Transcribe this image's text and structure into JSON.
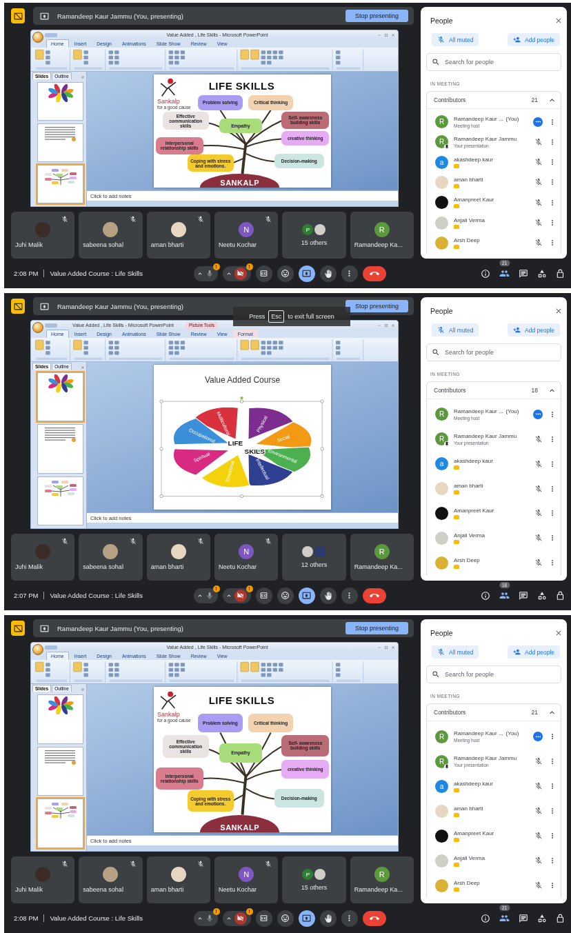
{
  "screens": [
    {
      "presenter_bar": {
        "label": "Ramandeep Kaur Jammu (You, presenting)",
        "button": "Stop presenting"
      },
      "ppt": {
        "title": "Value Added , Life Skills - Microsoft PowerPoint",
        "tabs": [
          {
            "label": "Home",
            "selected": true
          },
          {
            "label": "Insert",
            "selected": false
          },
          {
            "label": "Design",
            "selected": false
          },
          {
            "label": "Animations",
            "selected": false
          },
          {
            "label": "Slide Show",
            "selected": false
          },
          {
            "label": "Review",
            "selected": false
          },
          {
            "label": "View",
            "selected": false
          }
        ],
        "pane_tabs": [
          {
            "label": "Slides",
            "selected": true
          },
          {
            "label": "Outline",
            "selected": false
          }
        ],
        "thumbnails": [
          {
            "kind": "wheel",
            "selected": false
          },
          {
            "kind": "text",
            "selected": false
          },
          {
            "kind": "mindmap",
            "selected": true
          }
        ],
        "slide": {
          "kind": "mindmap",
          "title": "LIFE SKILLS",
          "logo": "Sankalp",
          "tagline": "for a good cause",
          "base": "SANKALP",
          "nodes": [
            {
              "text": "Problem solving",
              "color": "#a99cf2"
            },
            {
              "text": "Critical thinking",
              "color": "#f3d2b0"
            },
            {
              "text": "Effective communication skills",
              "color": "#e9e3e1"
            },
            {
              "text": "Empathy",
              "color": "#a9dc7a"
            },
            {
              "text": "Self- awareness building skills",
              "color": "#b96b76"
            },
            {
              "text": "creative thinking",
              "color": "#e6acf3"
            },
            {
              "text": "Interpersonal relationship skills",
              "color": "#d97c8e"
            },
            {
              "text": "Coping with stress and emotions.",
              "color": "#f4cb2e"
            },
            {
              "text": "Decision-making",
              "color": "#cbe6e1"
            }
          ]
        },
        "notes": "Click to add notes"
      },
      "tiles": [
        {
          "name": "Juhi Malik",
          "muted": true,
          "avatar": {
            "kind": "photo",
            "color": "#3b2c27"
          }
        },
        {
          "name": "sabeena sohal",
          "muted": true,
          "avatar": {
            "kind": "photo",
            "color": "#b7a185"
          }
        },
        {
          "name": "aman bharti",
          "muted": true,
          "avatar": {
            "kind": "photo",
            "color": "#e6d6c2"
          }
        },
        {
          "name": "Neetu Kochar",
          "muted": true,
          "avatar": {
            "kind": "letter",
            "letter": "N",
            "color": "#7e57c2"
          }
        },
        {
          "name": "15 others",
          "muted": false,
          "avatar": {
            "kind": "group",
            "members": [
              {
                "kind": "letter",
                "letter": "P",
                "color": "#2e7d32"
              },
              {
                "kind": "photo",
                "color": "#cfcfc8"
              }
            ]
          }
        },
        {
          "name": "Ramandeep Ka...",
          "muted": false,
          "avatar": {
            "kind": "letter",
            "letter": "R",
            "color": "#5b9a3c"
          }
        }
      ],
      "bar": {
        "time": "2:08 PM",
        "title": "Value Added Course : Life Skills",
        "controls": [
          {
            "kind": "mic-menu",
            "alert": "!"
          },
          {
            "kind": "camera-menu",
            "alert": "!"
          },
          {
            "kind": "captions"
          },
          {
            "kind": "emoji"
          },
          {
            "kind": "present",
            "on": true
          },
          {
            "kind": "hand"
          },
          {
            "kind": "more"
          },
          {
            "kind": "leave"
          }
        ],
        "side": [
          {
            "kind": "info"
          },
          {
            "kind": "people",
            "count": "21",
            "on": true
          },
          {
            "kind": "chat"
          },
          {
            "kind": "activities"
          },
          {
            "kind": "host-controls"
          }
        ]
      },
      "people": {
        "title": "People",
        "actions": [
          {
            "kind": "mute-all",
            "label": "All muted"
          },
          {
            "kind": "add",
            "label": "Add people"
          }
        ],
        "search": {
          "placeholder": "Search for people"
        },
        "section": "IN MEETING",
        "group": {
          "label": "Contributors",
          "count": "21",
          "expanded": true
        },
        "rows": [
          {
            "name": "Ramandeep Kaur ...",
            "tag": "(You)",
            "subtitle": "Meeting host",
            "badge": false,
            "kind": "more",
            "avatar": {
              "kind": "letter",
              "letter": "R",
              "color": "#5b9a3c",
              "pinned": false
            }
          },
          {
            "name": "Ramandeep Kaur Jammu",
            "subtitle": "Your presentation",
            "badge": false,
            "kind": "presentation",
            "avatar": {
              "kind": "letter",
              "letter": "R",
              "color": "#5b9a3c",
              "pinned": true
            }
          },
          {
            "name": "akashdeep kaur",
            "badge": true,
            "kind": "muted",
            "avatar": {
              "kind": "letter",
              "letter": "a",
              "color": "#1e88e5"
            }
          },
          {
            "name": "aman bharti",
            "badge": true,
            "kind": "muted",
            "avatar": {
              "kind": "photo",
              "color": "#e6d6c2"
            }
          },
          {
            "name": "Amanpreet Kaur",
            "badge": true,
            "kind": "muted",
            "avatar": {
              "kind": "photo",
              "color": "#111111"
            }
          },
          {
            "name": "Anjali Verma",
            "badge": true,
            "kind": "muted",
            "avatar": {
              "kind": "photo",
              "color": "#cfcfc8"
            }
          },
          {
            "name": "Arsh Deep",
            "badge": true,
            "kind": "muted",
            "avatar": {
              "kind": "photo",
              "color": "#d9b235"
            }
          }
        ]
      }
    },
    {
      "presenter_bar": {
        "label": "Ramandeep Kaur Jammu (You, presenting)",
        "button": "Stop presenting"
      },
      "esc_hint": {
        "before": "Press",
        "key": "Esc",
        "after": "to exit full screen"
      },
      "ppt": {
        "title": "Value Added , Life Skills - Microsoft PowerPoint",
        "context_label": "Picture Tools",
        "tabs": [
          {
            "label": "Home",
            "selected": true
          },
          {
            "label": "Insert",
            "selected": false
          },
          {
            "label": "Design",
            "selected": false
          },
          {
            "label": "Animations",
            "selected": false
          },
          {
            "label": "Slide Show",
            "selected": false
          },
          {
            "label": "Review",
            "selected": false
          },
          {
            "label": "View",
            "selected": false
          },
          {
            "label": "Format",
            "selected": false,
            "context": true
          }
        ],
        "pane_tabs": [
          {
            "label": "Slides",
            "selected": true
          },
          {
            "label": "Outline",
            "selected": false
          }
        ],
        "thumbnails": [
          {
            "kind": "wheel",
            "selected": true
          },
          {
            "kind": "text",
            "selected": false
          },
          {
            "kind": "mindmap",
            "selected": false
          }
        ],
        "slide": {
          "kind": "wheel",
          "title": "Value Added Course",
          "center_lines": [
            "LIFE",
            "SKILS"
          ],
          "picture_selected": true,
          "segments": [
            {
              "label": "Multicultural",
              "color": "#d9323e"
            },
            {
              "label": "Physical",
              "color": "#7d2d8f"
            },
            {
              "label": "Social",
              "color": "#f39a14"
            },
            {
              "label": "Environmental",
              "color": "#4caf50"
            },
            {
              "label": "Intellectual",
              "color": "#2f3f92"
            },
            {
              "label": "Emotional",
              "color": "#f3d20b"
            },
            {
              "label": "Spiritual",
              "color": "#d82a80"
            },
            {
              "label": "Occupational",
              "color": "#3c8fd9"
            }
          ]
        },
        "notes": "Click to add notes"
      },
      "tiles": [
        {
          "name": "Juhi Malik",
          "muted": true,
          "avatar": {
            "kind": "photo",
            "color": "#3b2c27"
          }
        },
        {
          "name": "sabeena sohal",
          "muted": true,
          "avatar": {
            "kind": "photo",
            "color": "#b7a185"
          }
        },
        {
          "name": "aman bharti",
          "muted": true,
          "avatar": {
            "kind": "photo",
            "color": "#e6d6c2"
          }
        },
        {
          "name": "Neetu Kochar",
          "muted": true,
          "avatar": {
            "kind": "letter",
            "letter": "N",
            "color": "#7e57c2"
          }
        },
        {
          "name": "12 others",
          "muted": false,
          "avatar": {
            "kind": "group",
            "members": [
              {
                "kind": "photo",
                "color": "#cfcfc8"
              },
              {
                "kind": "photo",
                "color": "#2a3a6a"
              }
            ]
          }
        },
        {
          "name": "Ramandeep Ka...",
          "muted": false,
          "avatar": {
            "kind": "letter",
            "letter": "R",
            "color": "#5b9a3c"
          }
        }
      ],
      "bar": {
        "time": "2:07 PM",
        "title": "Value Added Course : Life Skills",
        "controls": [
          {
            "kind": "mic-menu",
            "alert": "!"
          },
          {
            "kind": "camera-menu",
            "alert": "!"
          },
          {
            "kind": "captions"
          },
          {
            "kind": "emoji"
          },
          {
            "kind": "present",
            "on": true
          },
          {
            "kind": "hand"
          },
          {
            "kind": "more"
          },
          {
            "kind": "leave"
          }
        ],
        "side": [
          {
            "kind": "info"
          },
          {
            "kind": "people",
            "count": "18",
            "on": true
          },
          {
            "kind": "chat"
          },
          {
            "kind": "activities"
          },
          {
            "kind": "host-controls"
          }
        ]
      },
      "people": {
        "title": "People",
        "actions": [
          {
            "kind": "mute-all",
            "label": "All muted"
          },
          {
            "kind": "add",
            "label": "Add people"
          }
        ],
        "search": {
          "placeholder": "Search for people"
        },
        "section": "IN MEETING",
        "group": {
          "label": "Contributors",
          "count": "18",
          "expanded": true
        },
        "rows": [
          {
            "name": "Ramandeep Kaur ...",
            "tag": "(You)",
            "subtitle": "Meeting host",
            "badge": false,
            "kind": "more",
            "avatar": {
              "kind": "letter",
              "letter": "R",
              "color": "#5b9a3c",
              "pinned": false
            }
          },
          {
            "name": "Ramandeep Kaur Jammu",
            "subtitle": "Your presentation",
            "badge": false,
            "kind": "presentation",
            "avatar": {
              "kind": "letter",
              "letter": "R",
              "color": "#5b9a3c",
              "pinned": true
            }
          },
          {
            "name": "akashdeep kaur",
            "badge": true,
            "kind": "muted",
            "avatar": {
              "kind": "letter",
              "letter": "a",
              "color": "#1e88e5"
            }
          },
          {
            "name": "aman bharti",
            "badge": true,
            "kind": "muted",
            "avatar": {
              "kind": "photo",
              "color": "#e6d6c2"
            }
          },
          {
            "name": "Amanpreet Kaur",
            "badge": true,
            "kind": "muted",
            "avatar": {
              "kind": "photo",
              "color": "#111111"
            }
          },
          {
            "name": "Anjali Verma",
            "badge": true,
            "kind": "muted",
            "avatar": {
              "kind": "photo",
              "color": "#cfcfc8"
            }
          },
          {
            "name": "Arsh Deep",
            "badge": true,
            "kind": "muted",
            "avatar": {
              "kind": "photo",
              "color": "#d9b235"
            }
          }
        ]
      }
    },
    {
      "presenter_bar": {
        "label": "Ramandeep Kaur Jammu (You, presenting)",
        "button": "Stop presenting"
      },
      "ppt": {
        "title": "Value Added , Life Skills - Microsoft PowerPoint",
        "tabs": [
          {
            "label": "Home",
            "selected": true
          },
          {
            "label": "Insert",
            "selected": false
          },
          {
            "label": "Design",
            "selected": false
          },
          {
            "label": "Animations",
            "selected": false
          },
          {
            "label": "Slide Show",
            "selected": false
          },
          {
            "label": "Review",
            "selected": false
          },
          {
            "label": "View",
            "selected": false
          }
        ],
        "pane_tabs": [
          {
            "label": "Slides",
            "selected": true
          },
          {
            "label": "Outline",
            "selected": false
          }
        ],
        "thumbnails": [
          {
            "kind": "wheel",
            "selected": false
          },
          {
            "kind": "text",
            "selected": false
          },
          {
            "kind": "mindmap",
            "selected": true
          }
        ],
        "slide": {
          "kind": "mindmap",
          "title": "LIFE SKILLS",
          "logo": "Sankalp",
          "tagline": "for a good cause",
          "base": "SANKALP",
          "nodes": [
            {
              "text": "Problem solving",
              "color": "#a99cf2"
            },
            {
              "text": "Critical thinking",
              "color": "#f3d2b0"
            },
            {
              "text": "Effective communication skills",
              "color": "#e9e3e1"
            },
            {
              "text": "Empathy",
              "color": "#a9dc7a"
            },
            {
              "text": "Self- awareness building skills",
              "color": "#b96b76"
            },
            {
              "text": "creative thinking",
              "color": "#e6acf3"
            },
            {
              "text": "Interpersonal relationship skills",
              "color": "#d97c8e"
            },
            {
              "text": "Coping with stress and emotions.",
              "color": "#f4cb2e"
            },
            {
              "text": "Decision-making",
              "color": "#cbe6e1"
            }
          ]
        },
        "notes": "Click to add notes"
      },
      "tiles": [
        {
          "name": "Juhi Malik",
          "muted": true,
          "avatar": {
            "kind": "photo",
            "color": "#3b2c27"
          }
        },
        {
          "name": "sabeena sohal",
          "muted": true,
          "avatar": {
            "kind": "photo",
            "color": "#b7a185"
          }
        },
        {
          "name": "aman bharti",
          "muted": true,
          "avatar": {
            "kind": "photo",
            "color": "#e6d6c2"
          }
        },
        {
          "name": "Neetu Kochar",
          "muted": true,
          "avatar": {
            "kind": "letter",
            "letter": "N",
            "color": "#7e57c2"
          }
        },
        {
          "name": "15 others",
          "muted": false,
          "avatar": {
            "kind": "group",
            "members": [
              {
                "kind": "letter",
                "letter": "P",
                "color": "#2e7d32"
              },
              {
                "kind": "photo",
                "color": "#cfcfc8"
              }
            ]
          }
        },
        {
          "name": "Ramandeep Ka...",
          "muted": false,
          "avatar": {
            "kind": "letter",
            "letter": "R",
            "color": "#5b9a3c"
          }
        }
      ],
      "bar": {
        "time": "2:08 PM",
        "title": "Value Added Course : Life Skills",
        "controls": [
          {
            "kind": "mic-menu",
            "alert": "!"
          },
          {
            "kind": "camera-menu",
            "alert": "!"
          },
          {
            "kind": "captions"
          },
          {
            "kind": "emoji"
          },
          {
            "kind": "present",
            "on": true
          },
          {
            "kind": "hand"
          },
          {
            "kind": "more"
          },
          {
            "kind": "leave"
          }
        ],
        "side": [
          {
            "kind": "info"
          },
          {
            "kind": "people",
            "count": "21",
            "on": true
          },
          {
            "kind": "chat"
          },
          {
            "kind": "activities"
          },
          {
            "kind": "host-controls"
          }
        ]
      },
      "people": {
        "title": "People",
        "actions": [
          {
            "kind": "mute-all",
            "label": "All muted"
          },
          {
            "kind": "add",
            "label": "Add people"
          }
        ],
        "search": {
          "placeholder": "Search for people"
        },
        "section": "IN MEETING",
        "group": {
          "label": "Contributors",
          "count": "21",
          "expanded": true
        },
        "rows": [
          {
            "name": "Ramandeep Kaur ...",
            "tag": "(You)",
            "subtitle": "Meeting host",
            "badge": false,
            "kind": "more",
            "avatar": {
              "kind": "letter",
              "letter": "R",
              "color": "#5b9a3c",
              "pinned": false
            }
          },
          {
            "name": "Ramandeep Kaur Jammu",
            "subtitle": "Your presentation",
            "badge": false,
            "kind": "presentation",
            "avatar": {
              "kind": "letter",
              "letter": "R",
              "color": "#5b9a3c",
              "pinned": true
            }
          },
          {
            "name": "akashdeep kaur",
            "badge": true,
            "kind": "muted",
            "avatar": {
              "kind": "letter",
              "letter": "a",
              "color": "#1e88e5"
            }
          },
          {
            "name": "aman bharti",
            "badge": true,
            "kind": "muted",
            "avatar": {
              "kind": "photo",
              "color": "#e6d6c2"
            }
          },
          {
            "name": "Amanpreet Kaur",
            "badge": true,
            "kind": "muted",
            "avatar": {
              "kind": "photo",
              "color": "#111111"
            }
          },
          {
            "name": "Anjali Verma",
            "badge": true,
            "kind": "muted",
            "avatar": {
              "kind": "photo",
              "color": "#cfcfc8"
            }
          },
          {
            "name": "Arsh Deep",
            "badge": true,
            "kind": "muted",
            "avatar": {
              "kind": "photo",
              "color": "#d9b235"
            }
          }
        ]
      }
    }
  ]
}
